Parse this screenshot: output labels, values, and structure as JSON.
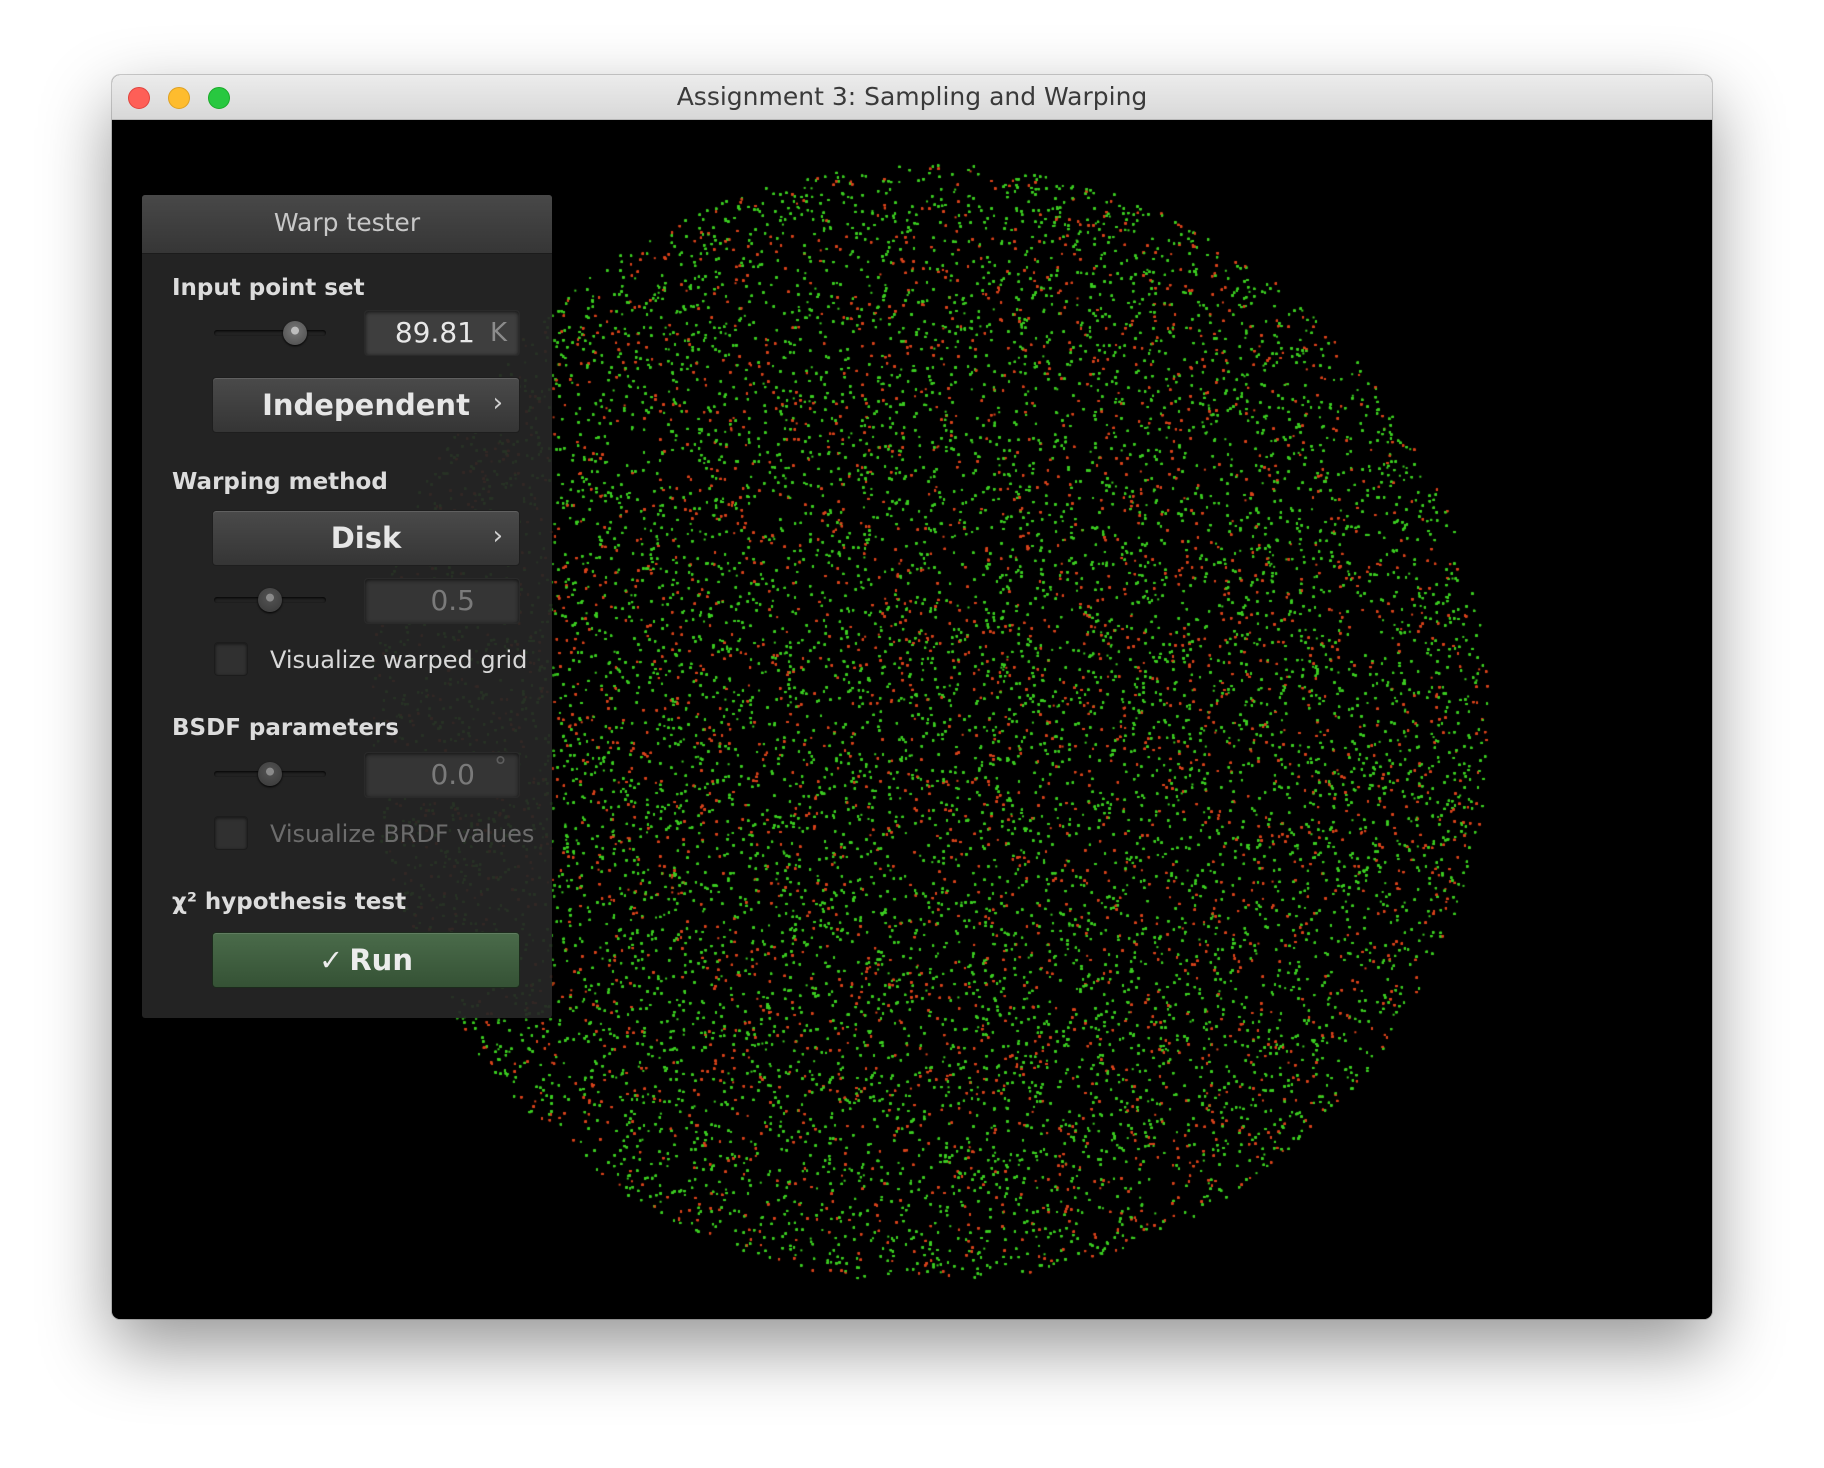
{
  "window": {
    "title": "Assignment 3: Sampling and Warping"
  },
  "visualization": {
    "shape": "disk",
    "point_colors": [
      "#3ccc22",
      "#d8431c"
    ],
    "background": "#000000"
  },
  "panel": {
    "title": "Warp tester",
    "input_point_set": {
      "label": "Input point set",
      "count_value": "89.81",
      "count_unit": "K",
      "slider_fraction": 0.78,
      "sampler": "Independent",
      "sampler_chevron": "›"
    },
    "warping_method": {
      "label": "Warping method",
      "method": "Disk",
      "method_chevron": "›",
      "param_value": "0.5",
      "slider_fraction": 0.5,
      "visualize_grid_label": "Visualize warped grid",
      "visualize_grid_checked": false
    },
    "bsdf": {
      "label": "BSDF parameters",
      "angle_value": "0.0",
      "angle_unit": "°",
      "slider_fraction": 0.5,
      "visualize_brdf_label": "Visualize BRDF values",
      "visualize_brdf_checked": false
    },
    "chi2": {
      "label": "χ² hypothesis test",
      "run_icon": "✓",
      "run_label": "Run"
    }
  }
}
